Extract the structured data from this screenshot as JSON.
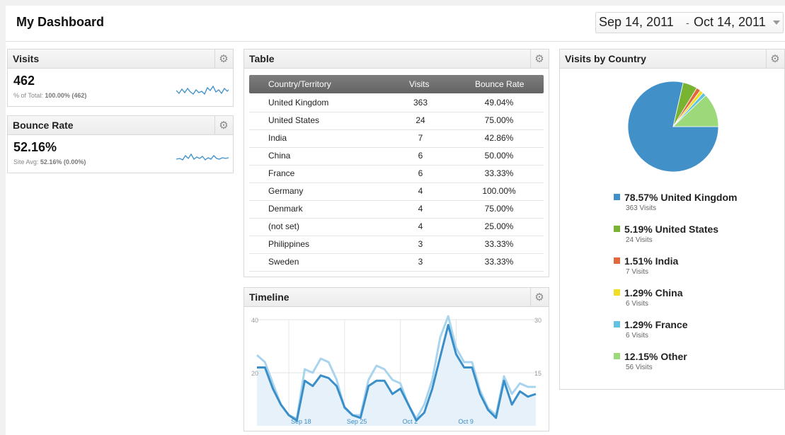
{
  "header": {
    "title": "My Dashboard",
    "date_start": "Sep 14, 2011",
    "date_sep": "-",
    "date_end": "Oct 14, 2011"
  },
  "icons": {
    "gear": "gear-icon",
    "dropdown": "chevron-down-icon"
  },
  "visits_widget": {
    "title": "Visits",
    "value": "462",
    "sub_label": "% of Total: ",
    "sub_value": "100.00% (462)"
  },
  "bounce_widget": {
    "title": "Bounce Rate",
    "value": "52.16%",
    "sub_label": "Site Avg: ",
    "sub_value": "52.16% (0.00%)"
  },
  "table_widget": {
    "title": "Table",
    "columns": [
      "Country/Territory",
      "Visits",
      "Bounce Rate"
    ],
    "rows": [
      [
        "United Kingdom",
        "363",
        "49.04%"
      ],
      [
        "United States",
        "24",
        "75.00%"
      ],
      [
        "India",
        "7",
        "42.86%"
      ],
      [
        "China",
        "6",
        "50.00%"
      ],
      [
        "France",
        "6",
        "33.33%"
      ],
      [
        "Germany",
        "4",
        "100.00%"
      ],
      [
        "Denmark",
        "4",
        "75.00%"
      ],
      [
        "(not set)",
        "4",
        "25.00%"
      ],
      [
        "Philippines",
        "3",
        "33.33%"
      ],
      [
        "Sweden",
        "3",
        "33.33%"
      ]
    ]
  },
  "country_widget": {
    "title": "Visits by Country",
    "legend": [
      {
        "pct": "78.57%",
        "name": "United Kingdom",
        "visits": "363 Visits",
        "color": "#4191c8"
      },
      {
        "pct": "5.19%",
        "name": "United States",
        "visits": "24 Visits",
        "color": "#79b332"
      },
      {
        "pct": "1.51%",
        "name": "India",
        "visits": "7 Visits",
        "color": "#e0683c"
      },
      {
        "pct": "1.29%",
        "name": "China",
        "visits": "6 Visits",
        "color": "#f0dd25"
      },
      {
        "pct": "1.29%",
        "name": "France",
        "visits": "6 Visits",
        "color": "#62c3e0"
      },
      {
        "pct": "12.15%",
        "name": "Other",
        "visits": "56 Visits",
        "color": "#9cd97a"
      }
    ]
  },
  "timeline_widget": {
    "title": "Timeline"
  },
  "chart_data": [
    {
      "type": "pie",
      "title": "Visits by Country",
      "categories": [
        "United Kingdom",
        "United States",
        "India",
        "China",
        "France",
        "Other"
      ],
      "values": [
        78.57,
        5.19,
        1.51,
        1.29,
        1.29,
        12.15
      ],
      "colors": [
        "#4191c8",
        "#79b332",
        "#e0683c",
        "#f0dd25",
        "#62c3e0",
        "#9cd97a"
      ]
    },
    {
      "type": "line",
      "title": "Timeline",
      "x_tick_labels": [
        "Sep 18",
        "Sep 25",
        "Oct 2",
        "Oct 9"
      ],
      "y_left_ticks": [
        20,
        40
      ],
      "y_right_ticks": [
        15,
        30
      ],
      "ylim_left": [
        0,
        40
      ],
      "ylim_right": [
        0,
        30
      ],
      "series": [
        {
          "color": "#3b8fc9",
          "axis": "left",
          "values": [
            22,
            22,
            14,
            8,
            4,
            2,
            17,
            15,
            19,
            18,
            15,
            7,
            4,
            3,
            15,
            17,
            17,
            12,
            14,
            8,
            2,
            5,
            14,
            26,
            38,
            27,
            22,
            22,
            12,
            6,
            3,
            17,
            8,
            13,
            11,
            12
          ]
        },
        {
          "color": "#a9d4ee",
          "axis": "right",
          "values": [
            20,
            18,
            12,
            6,
            3,
            2,
            16,
            15,
            19,
            18,
            13,
            5,
            3,
            3,
            13,
            17,
            16,
            13,
            12,
            6,
            2,
            6,
            13,
            25,
            31,
            22,
            18,
            18,
            10,
            5,
            3,
            14,
            9,
            12,
            11,
            11
          ]
        }
      ]
    }
  ]
}
